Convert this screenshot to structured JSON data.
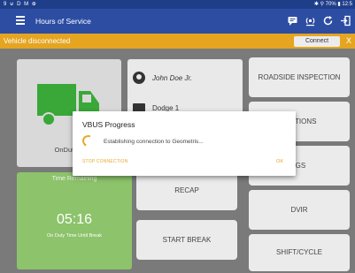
{
  "status_bar": {
    "left_icons": "9 ⊌ D M ⊕",
    "right": "✱ ⚲ 70% ▮ 12:5"
  },
  "app_bar": {
    "title": "Hours of Service",
    "icons": [
      "menu-icon",
      "message-icon",
      "eld-icon",
      "refresh-icon",
      "logout-icon"
    ]
  },
  "banner": {
    "text": "Vehicle disconnected",
    "connect_label": "Connect",
    "close_label": "X",
    "color": "#e5a521"
  },
  "driver": {
    "status": "OnDuty N",
    "name": "John Doe Jr.",
    "vehicle": "Dodge 1"
  },
  "time_remaining": {
    "label": "Time Remaining",
    "value": "05:16",
    "sublabel": "On Duty Time Until Break",
    "color": "#8cc36b"
  },
  "buttons": {
    "roadside": "ROADSIDE INSPECTION",
    "violations": "TIONS",
    "logs": "LOGS",
    "recap": "RECAP",
    "dvir": "DVIR",
    "start_break": "START BREAK",
    "shift_cycle": "SHIFT/CYCLE"
  },
  "dialog": {
    "title": "VBUS Progress",
    "message": "Establishing connection to Geometris...",
    "stop_label": "STOP CONNECTION",
    "ok_label": "OK",
    "accent": "#e9a72a"
  }
}
